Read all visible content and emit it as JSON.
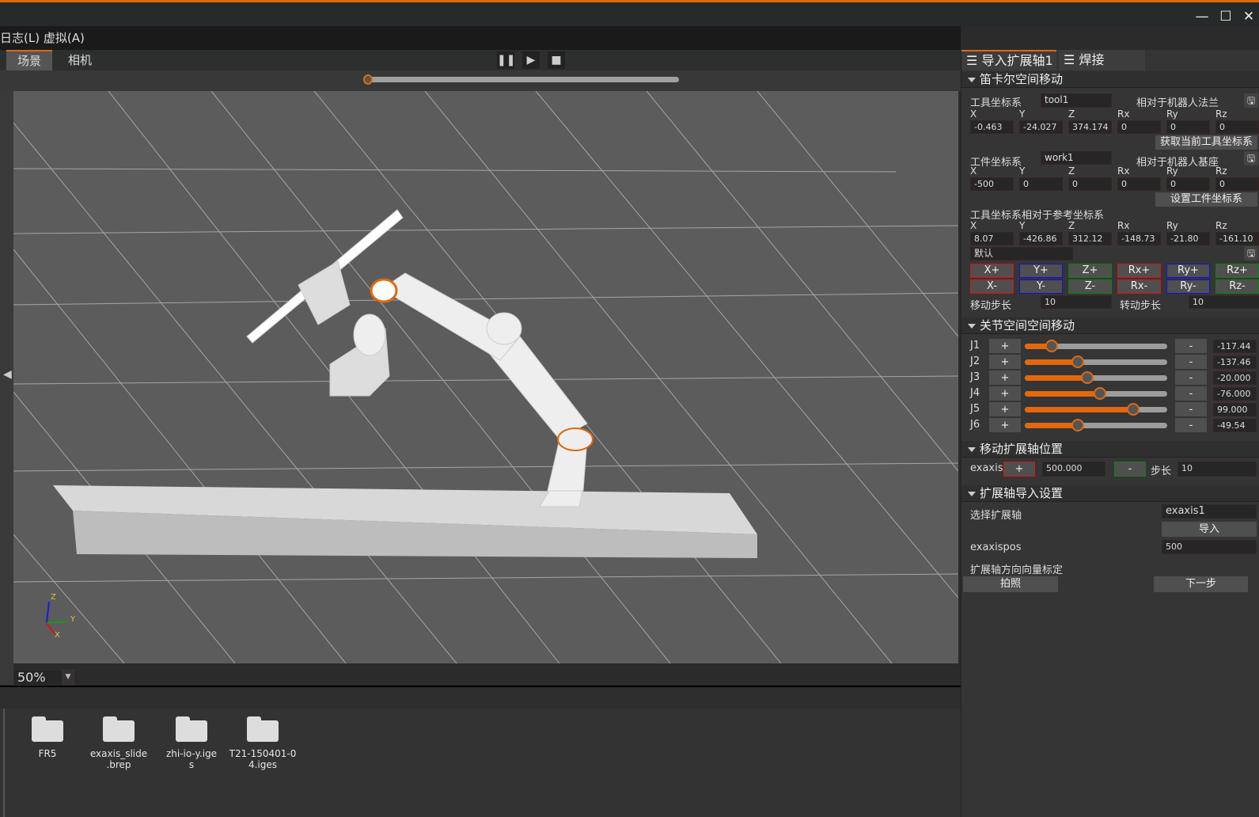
{
  "window": {
    "controls": [
      "minimize",
      "maximize",
      "close"
    ]
  },
  "menu": {
    "items": [
      "日志(L)",
      "虚拟(A)"
    ]
  },
  "view_tabs": [
    {
      "label": "场景",
      "active": true
    },
    {
      "label": "相机",
      "active": false
    }
  ],
  "playback": {
    "pause": "pause-icon",
    "play": "play-icon",
    "stop": "stop-icon",
    "progress": 0
  },
  "zoom": {
    "value": "50%"
  },
  "files": [
    {
      "name": "FR5"
    },
    {
      "name": "exaxis_slide\n.brep"
    },
    {
      "name": "zhi-io-y.ige\ns"
    },
    {
      "name": "T21-150401-0\n4.iges"
    }
  ],
  "axis_gizmo": {
    "z": "Z",
    "y": "Y",
    "x": "X"
  },
  "panel": {
    "tabs": [
      {
        "label": "导入扩展轴1",
        "active": true
      },
      {
        "label": "焊接",
        "active": false
      }
    ],
    "cartesian": {
      "title": "笛卡尔空间移动",
      "tool_label": "工具坐标系",
      "tool_value": "tool1",
      "tool_rel": "相对于机器人法兰",
      "axes": [
        "X",
        "Y",
        "Z",
        "Rx",
        "Ry",
        "Rz"
      ],
      "tool_values": [
        "-0.463",
        "-24.027",
        "374.174",
        "0",
        "0",
        "0"
      ],
      "get_tool_button": "获取当前工具坐标系",
      "work_label": "工件坐标系",
      "work_value": "work1",
      "work_rel": "相对于机器人基座",
      "work_values": [
        "-500",
        "0",
        "0",
        "0",
        "0",
        "0"
      ],
      "set_work_button": "设置工件坐标系",
      "ref_label": "工具坐标系相对于参考坐标系",
      "ref_values": [
        "8.07",
        "-426.86",
        "312.12",
        "-148.73",
        "-21.80",
        "-161.10"
      ],
      "ref_frame": "默认",
      "jog_plus": [
        "X+",
        "Y+",
        "Z+",
        "Rx+",
        "Ry+",
        "Rz+"
      ],
      "jog_minus": [
        "X-",
        "Y-",
        "Z-",
        "Rx-",
        "Ry-",
        "Rz-"
      ],
      "move_step_label": "移动步长",
      "move_step": "10",
      "rot_step_label": "转动步长",
      "rot_step": "10"
    },
    "joint": {
      "title": "关节空间空间移动",
      "plus": "+",
      "minus": "-",
      "joints": [
        {
          "label": "J1",
          "value": "-117.44",
          "fraction": 0.19
        },
        {
          "label": "J2",
          "value": "-137.46",
          "fraction": 0.37
        },
        {
          "label": "J3",
          "value": "-20.000",
          "fraction": 0.44
        },
        {
          "label": "J4",
          "value": "-76.000",
          "fraction": 0.53
        },
        {
          "label": "J5",
          "value": "99.000",
          "fraction": 0.76
        },
        {
          "label": "J6",
          "value": "-49.54",
          "fraction": 0.37
        }
      ]
    },
    "exaxis_move": {
      "title": "移动扩展轴位置",
      "label": "exaxis",
      "plus": "+",
      "value": "500.000",
      "minus": "-",
      "step_label": "步长",
      "step": "10"
    },
    "exaxis_import": {
      "title": "扩展轴导入设置",
      "select_label": "选择扩展轴",
      "select_value": "exaxis1",
      "import_button": "导入",
      "pos_label": "exaxispos",
      "pos_value": "500",
      "calib_label": "扩展轴方向向量标定",
      "photo_button": "拍照",
      "next_button": "下一步"
    }
  },
  "colors": {
    "accent": "#e0690f",
    "x": "#e01010",
    "y": "#1010e0",
    "z": "#108010"
  }
}
